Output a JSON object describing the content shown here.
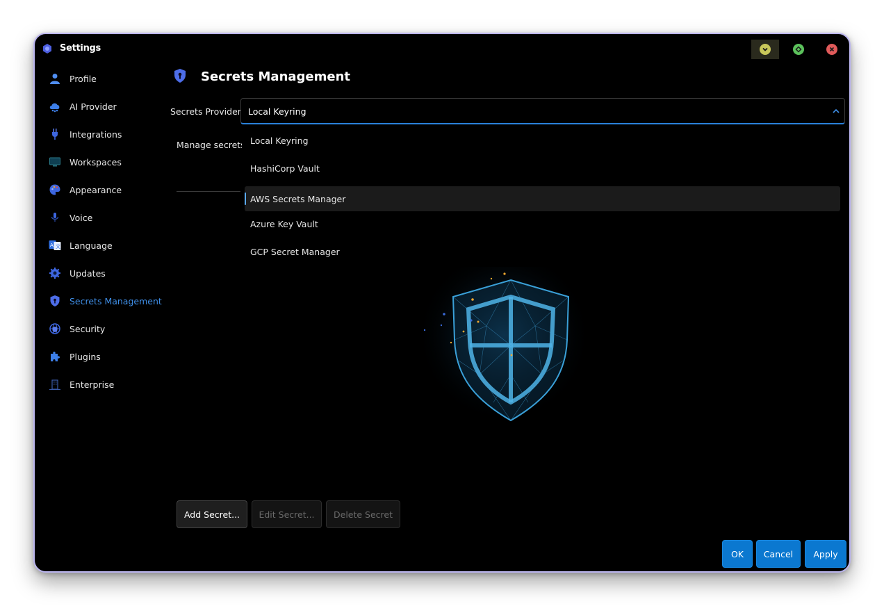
{
  "window": {
    "title": "Settings"
  },
  "sidebar": {
    "items": [
      {
        "label": "Profile",
        "icon": "user-icon"
      },
      {
        "label": "AI Provider",
        "icon": "cloud-ai-icon"
      },
      {
        "label": "Integrations",
        "icon": "plug-icon"
      },
      {
        "label": "Workspaces",
        "icon": "monitor-icon"
      },
      {
        "label": "Appearance",
        "icon": "palette-icon"
      },
      {
        "label": "Voice",
        "icon": "microphone-icon"
      },
      {
        "label": "Language",
        "icon": "translate-icon"
      },
      {
        "label": "Updates",
        "icon": "gear-icon"
      },
      {
        "label": "Secrets Management",
        "icon": "shield-keyhole-icon",
        "active": true
      },
      {
        "label": "Security",
        "icon": "security-globe-icon"
      },
      {
        "label": "Plugins",
        "icon": "puzzle-icon"
      },
      {
        "label": "Enterprise",
        "icon": "building-icon"
      }
    ]
  },
  "main": {
    "heading": "Secrets Management",
    "provider_label": "Secrets Provider:",
    "provider_value": "Local Keyring",
    "manage_text": "Manage secrets",
    "provider_options": [
      "Local Keyring",
      "HashiCorp Vault",
      "AWS Secrets Manager",
      "Azure Key Vault",
      "GCP Secret Manager"
    ],
    "selected_option": "AWS Secrets Manager",
    "buttons": {
      "add": "Add Secret...",
      "edit": "Edit Secret...",
      "delete": "Delete Secret"
    }
  },
  "footer": {
    "ok": "OK",
    "cancel": "Cancel",
    "apply": "Apply"
  },
  "colors": {
    "accent": "#0b78d0",
    "active_nav": "#3f8fe8",
    "window_border": "#bcb6f0",
    "background": "#000000"
  }
}
